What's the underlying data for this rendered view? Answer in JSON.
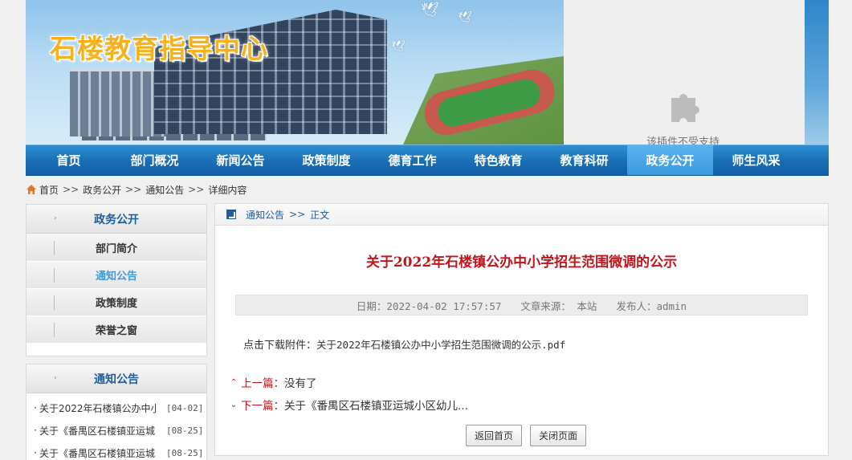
{
  "site": {
    "title": "石楼教育指导中心"
  },
  "plugin": {
    "message": "该插件不受支持"
  },
  "nav": [
    {
      "label": "首页"
    },
    {
      "label": "部门概况"
    },
    {
      "label": "新闻公告"
    },
    {
      "label": "政策制度"
    },
    {
      "label": "德育工作"
    },
    {
      "label": "特色教育"
    },
    {
      "label": "教育科研"
    },
    {
      "label": "政务公开",
      "active": true
    },
    {
      "label": "师生风采"
    }
  ],
  "breadcrumb": {
    "sep": ">>",
    "items": [
      "首页",
      "政务公开",
      "通知公告",
      "详细内容"
    ]
  },
  "sidebar": {
    "section_title": "政务公开",
    "menu": [
      {
        "label": "部门简介"
      },
      {
        "label": "通知公告",
        "active": true
      },
      {
        "label": "政策制度"
      },
      {
        "label": "荣誉之窗"
      }
    ],
    "notices_title": "通知公告",
    "notices": [
      {
        "title": "关于2022年石楼镇公办中小",
        "date": "[04-02]"
      },
      {
        "title": "关于《番禺区石楼镇亚运城",
        "date": "[08-25]"
      },
      {
        "title": "关于《番禺区石楼镇亚运城",
        "date": "[08-25]"
      }
    ]
  },
  "content": {
    "crumb": [
      "通知公告",
      "正文"
    ],
    "crumb_sep": ">>",
    "title": "关于2022年石楼镇公办中小学招生范围微调的公示",
    "meta": {
      "date": "日期：2022-04-02 17:57:57",
      "source": "文章来源： 本站",
      "publisher": "发布人：admin"
    },
    "attachment_label": "点击下载附件：",
    "attachment_file": "关于2022年石楼镇公办中小学招生范围微调的公示.pdf",
    "prev_label": "上一篇：",
    "prev_value": "没有了",
    "next_label": "下一篇：",
    "next_value": "关于《番禺区石楼镇亚运城小区幼儿...",
    "btn_home": "返回首页",
    "btn_close": "关闭页面"
  },
  "colors": {
    "nav_bg": "#1a70b8",
    "nav_active": "#4aa6e6",
    "title_red": "#c0161b",
    "link_blue": "#1c5e9e",
    "site_title": "#f7b21b"
  }
}
